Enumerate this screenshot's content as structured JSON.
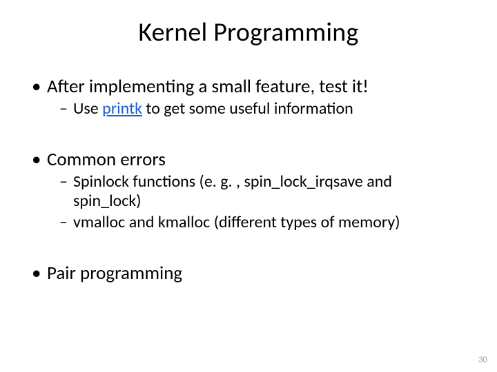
{
  "title": "Kernel Programming",
  "items": [
    {
      "text": "After implementing a small feature, test it!",
      "sub": [
        {
          "prefix": "Use ",
          "link": "printk",
          "suffix": " to get some useful information"
        }
      ]
    },
    {
      "text": "Common errors",
      "sub": [
        {
          "line1": "Spinlock functions (e. g. , spin_lock_irqsave and",
          "line2": "spin_lock)"
        },
        {
          "text": "vmalloc and kmalloc (different types of memory)"
        }
      ]
    },
    {
      "text": "Pair programming",
      "sub": []
    }
  ],
  "page_number": "30"
}
